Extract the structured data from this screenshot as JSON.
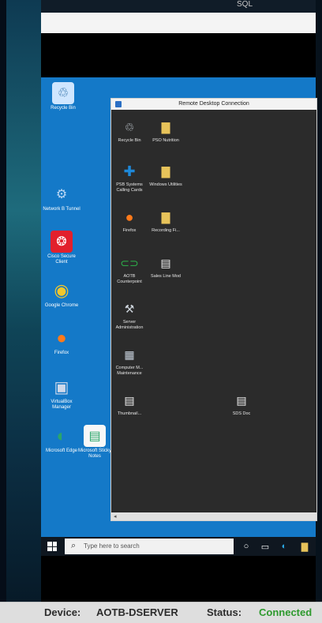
{
  "top_readout": "SQL",
  "desktop": {
    "icons": [
      {
        "label": "Recycle Bin",
        "icon": "recycle-bin-icon",
        "glyph": "♲",
        "color": "#cfe6ff"
      },
      {
        "label": "Network B Tunnel",
        "icon": "network-tunnel-icon",
        "glyph": "⚙",
        "color": "#bcd8f5"
      },
      {
        "label": "Cisco Secure Client",
        "icon": "cisco-icon",
        "glyph": "❂",
        "color": "#e2202c"
      },
      {
        "label": "Google Chrome",
        "icon": "chrome-icon",
        "glyph": "◉",
        "color": "#f2c72c"
      },
      {
        "label": "Firefox",
        "icon": "firefox-icon",
        "glyph": "●",
        "color": "#ff7a1a"
      },
      {
        "label": "VirtualBox Manager",
        "icon": "virtualbox-icon",
        "glyph": "▣",
        "color": "#3c5a9a"
      },
      {
        "label": "Microsoft Edge",
        "icon": "edge-icon",
        "glyph": "◐",
        "color": "#2aa66a"
      },
      {
        "label": "Microsoft Sticky Notes",
        "icon": "notepad-icon",
        "glyph": "▤",
        "color": "#f7f7f7"
      }
    ]
  },
  "rdc": {
    "title": "Remote Desktop Connection",
    "icons": [
      {
        "label": "Recycle Bin",
        "icon": "recycle-bin-icon",
        "glyph": "🗑",
        "color": "#d0d8e0"
      },
      {
        "label": "PSO Nutrition",
        "icon": "folder-icon",
        "glyph": "▇",
        "color": "#e7c35a"
      },
      {
        "label": "PSB Systems Calling Cards",
        "icon": "psb-icon",
        "glyph": "✚",
        "color": "#1e88d8"
      },
      {
        "label": "Windows Utilities",
        "icon": "folder-icon",
        "glyph": "▇",
        "color": "#e7c35a"
      },
      {
        "label": "Firefox",
        "icon": "firefox-icon",
        "glyph": "●",
        "color": "#ff7a1a"
      },
      {
        "label": "Recording Fi...",
        "icon": "folder-icon",
        "glyph": "▇",
        "color": "#e7c35a"
      },
      {
        "label": "AOTB Counterpoint",
        "icon": "counterpoint-icon",
        "glyph": "⊂⊃",
        "color": "#2db14a"
      },
      {
        "label": "Sales Line Mod",
        "icon": "document-icon",
        "glyph": "▤",
        "color": "#f4f4f4"
      },
      {
        "label": "Server Administration",
        "icon": "server-admin-icon",
        "glyph": "⚒",
        "color": "#cfd6de"
      },
      {
        "label": "Computer M... Maintenance",
        "icon": "computer-icon",
        "glyph": "▦",
        "color": "#c7d1dc"
      },
      {
        "label": "Thumbnail...",
        "icon": "document-icon",
        "glyph": "▤",
        "color": "#f4f4f4"
      },
      {
        "label": "SDS Doc",
        "icon": "document-icon",
        "glyph": "▤",
        "color": "#f0f0f0"
      }
    ]
  },
  "taskbar": {
    "search_placeholder": "Type here to search",
    "icons": [
      {
        "name": "task-view-icon",
        "glyph": "○"
      },
      {
        "name": "file-explorer-icon",
        "glyph": "▭"
      },
      {
        "name": "edge-icon",
        "glyph": "◐"
      },
      {
        "name": "folder-icon",
        "glyph": "▇"
      }
    ]
  },
  "status_bar": {
    "device_label": "Device:",
    "device_value": "AOTB-DSERVER",
    "status_label": "Status:",
    "status_value": "Connected",
    "status_color": "#2e9a2e"
  }
}
